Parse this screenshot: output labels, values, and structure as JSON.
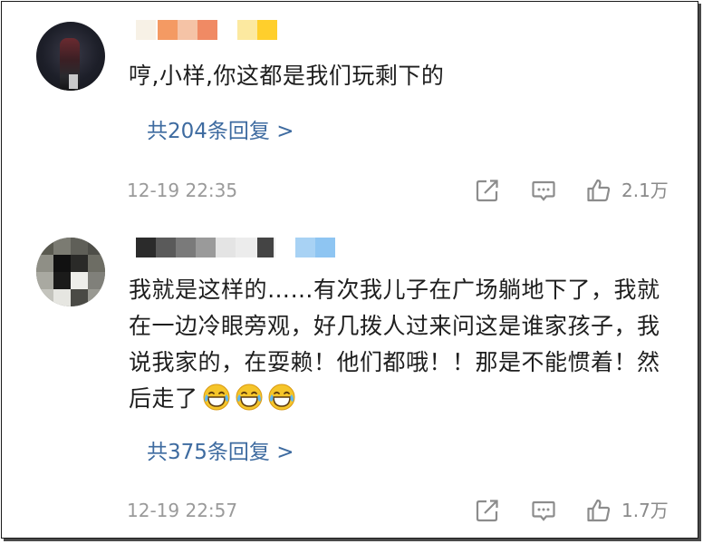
{
  "comments": [
    {
      "text": "哼,小样,你这都是我们玩剩下的",
      "replies_link": "共204条回复 >",
      "timestamp": "12-19 22:35",
      "likes": "2.1万",
      "avatar_icon": "user-avatar-blurred",
      "username_redacted": true
    },
    {
      "text": "我就是这样的……有次我儿子在广场躺地下了，我就在一边冷眼旁观，好几拨人过来问这是谁家孩子，我说我家的，在耍赖！他们都哦！！那是不能惯着！然后走了",
      "emojis": [
        "laughing-tears-emoji",
        "laughing-tears-emoji",
        "laughing-tears-emoji"
      ],
      "replies_link": "共375条回复 >",
      "timestamp": "12-19 22:57",
      "likes": "1.7万",
      "avatar_icon": "user-avatar-pixelated",
      "username_redacted": true
    }
  ],
  "icons": {
    "share": "share-icon",
    "reply": "comment-icon",
    "like": "thumbs-up-icon"
  },
  "colors": {
    "text": "#1e1e1e",
    "link": "#3e6ba0",
    "meta": "#9a9a9a",
    "icon": "#8c8c8c",
    "emoji_face": "#f5c52a"
  }
}
